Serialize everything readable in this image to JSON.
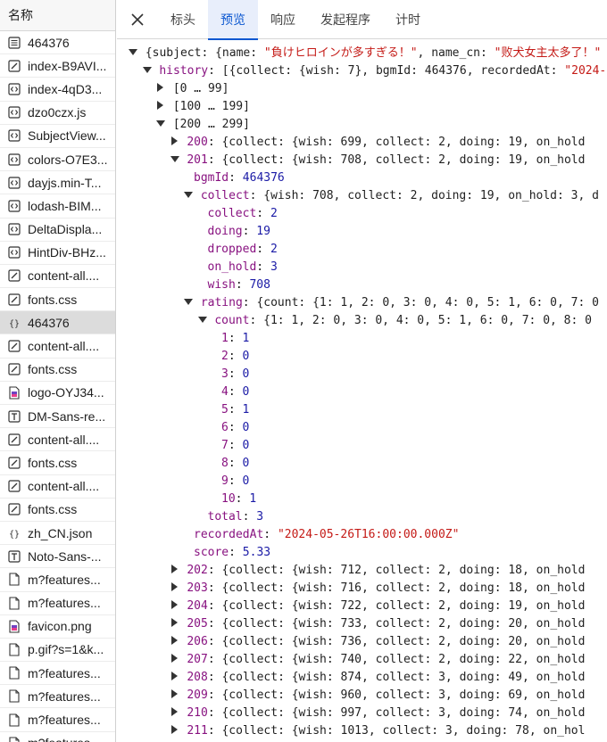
{
  "left_panel": {
    "header": "名称",
    "requests": [
      {
        "name": "464376",
        "icon": "document-icon",
        "selected": false
      },
      {
        "name": "index-B9AVI...",
        "icon": "script-icon",
        "selected": false
      },
      {
        "name": "index-4qD3...",
        "icon": "code-icon",
        "selected": false
      },
      {
        "name": "dzo0czx.js",
        "icon": "code-icon",
        "selected": false
      },
      {
        "name": "SubjectView...",
        "icon": "code-icon",
        "selected": false
      },
      {
        "name": "colors-O7E3...",
        "icon": "code-icon",
        "selected": false
      },
      {
        "name": "dayjs.min-T...",
        "icon": "code-icon",
        "selected": false
      },
      {
        "name": "lodash-BIM...",
        "icon": "code-icon",
        "selected": false
      },
      {
        "name": "DeltaDispla...",
        "icon": "code-icon",
        "selected": false
      },
      {
        "name": "HintDiv-BHz...",
        "icon": "code-icon",
        "selected": false
      },
      {
        "name": "content-all....",
        "icon": "script-icon",
        "selected": false
      },
      {
        "name": "fonts.css",
        "icon": "script-icon",
        "selected": false
      },
      {
        "name": "464376",
        "icon": "json-icon",
        "selected": true
      },
      {
        "name": "content-all....",
        "icon": "script-icon",
        "selected": false
      },
      {
        "name": "fonts.css",
        "icon": "script-icon",
        "selected": false
      },
      {
        "name": "logo-OYJ34...",
        "icon": "image-icon",
        "selected": false
      },
      {
        "name": "DM-Sans-re...",
        "icon": "font-icon",
        "selected": false
      },
      {
        "name": "content-all....",
        "icon": "script-icon",
        "selected": false
      },
      {
        "name": "fonts.css",
        "icon": "script-icon",
        "selected": false
      },
      {
        "name": "content-all....",
        "icon": "script-icon",
        "selected": false
      },
      {
        "name": "fonts.css",
        "icon": "script-icon",
        "selected": false
      },
      {
        "name": "zh_CN.json",
        "icon": "json-icon",
        "selected": false
      },
      {
        "name": "Noto-Sans-...",
        "icon": "font-icon",
        "selected": false
      },
      {
        "name": "m?features...",
        "icon": "file-icon",
        "selected": false
      },
      {
        "name": "m?features...",
        "icon": "file-icon",
        "selected": false
      },
      {
        "name": "favicon.png",
        "icon": "image-icon",
        "selected": false
      },
      {
        "name": "p.gif?s=1&k...",
        "icon": "file-icon",
        "selected": false
      },
      {
        "name": "m?features...",
        "icon": "file-icon",
        "selected": false
      },
      {
        "name": "m?features...",
        "icon": "file-icon",
        "selected": false
      },
      {
        "name": "m?features...",
        "icon": "file-icon",
        "selected": false
      },
      {
        "name": "m?features...",
        "icon": "file-icon",
        "selected": false
      }
    ]
  },
  "tabs": [
    {
      "label": "标头",
      "active": false
    },
    {
      "label": "预览",
      "active": true
    },
    {
      "label": "响应",
      "active": false
    },
    {
      "label": "发起程序",
      "active": false
    },
    {
      "label": "计时",
      "active": false
    }
  ],
  "tree": [
    {
      "indent": 0,
      "tri": "down",
      "parts": [
        [
          "p",
          "{subject: {name: "
        ],
        [
          "s",
          "\"負けヒロインが多すぎる！\""
        ],
        [
          "p",
          ", name_cn: "
        ],
        [
          "s",
          "\"败犬女主太多了！\""
        ]
      ]
    },
    {
      "indent": 1,
      "tri": "down",
      "parts": [
        [
          "k",
          "history"
        ],
        [
          "p",
          ": [{collect: {wish: 7}, bgmId: 464376, recordedAt: "
        ],
        [
          "s",
          "\"2024-"
        ]
      ]
    },
    {
      "indent": 2,
      "tri": "right",
      "parts": [
        [
          "p",
          "[0 … 99]"
        ]
      ]
    },
    {
      "indent": 2,
      "tri": "right",
      "parts": [
        [
          "p",
          "[100 … 199]"
        ]
      ]
    },
    {
      "indent": 2,
      "tri": "down",
      "parts": [
        [
          "p",
          "[200 … 299]"
        ]
      ]
    },
    {
      "indent": 3,
      "tri": "right",
      "parts": [
        [
          "k",
          "200"
        ],
        [
          "p",
          ": {collect: {wish: 699, collect: 2, doing: 19, on_hold"
        ]
      ]
    },
    {
      "indent": 3,
      "tri": "down",
      "parts": [
        [
          "k",
          "201"
        ],
        [
          "p",
          ": {collect: {wish: 708, collect: 2, doing: 19, on_hold"
        ]
      ]
    },
    {
      "indent": 4,
      "tri": "",
      "parts": [
        [
          "k",
          "bgmId"
        ],
        [
          "p",
          ": "
        ],
        [
          "n",
          "464376"
        ]
      ]
    },
    {
      "indent": 4,
      "tri": "down",
      "parts": [
        [
          "k",
          "collect"
        ],
        [
          "p",
          ": {wish: 708, collect: 2, doing: 19, on_hold: 3, d"
        ]
      ]
    },
    {
      "indent": 5,
      "tri": "",
      "parts": [
        [
          "k",
          "collect"
        ],
        [
          "p",
          ": "
        ],
        [
          "n",
          "2"
        ]
      ]
    },
    {
      "indent": 5,
      "tri": "",
      "parts": [
        [
          "k",
          "doing"
        ],
        [
          "p",
          ": "
        ],
        [
          "n",
          "19"
        ]
      ]
    },
    {
      "indent": 5,
      "tri": "",
      "parts": [
        [
          "k",
          "dropped"
        ],
        [
          "p",
          ": "
        ],
        [
          "n",
          "2"
        ]
      ]
    },
    {
      "indent": 5,
      "tri": "",
      "parts": [
        [
          "k",
          "on_hold"
        ],
        [
          "p",
          ": "
        ],
        [
          "n",
          "3"
        ]
      ]
    },
    {
      "indent": 5,
      "tri": "",
      "parts": [
        [
          "k",
          "wish"
        ],
        [
          "p",
          ": "
        ],
        [
          "n",
          "708"
        ]
      ]
    },
    {
      "indent": 4,
      "tri": "down",
      "parts": [
        [
          "k",
          "rating"
        ],
        [
          "p",
          ": {count: {1: 1, 2: 0, 3: 0, 4: 0, 5: 1, 6: 0, 7: 0"
        ]
      ]
    },
    {
      "indent": 5,
      "tri": "down",
      "parts": [
        [
          "k",
          "count"
        ],
        [
          "p",
          ": {1: 1, 2: 0, 3: 0, 4: 0, 5: 1, 6: 0, 7: 0, 8: 0"
        ]
      ]
    },
    {
      "indent": 6,
      "tri": "",
      "parts": [
        [
          "k",
          "1"
        ],
        [
          "p",
          ": "
        ],
        [
          "n",
          "1"
        ]
      ]
    },
    {
      "indent": 6,
      "tri": "",
      "parts": [
        [
          "k",
          "2"
        ],
        [
          "p",
          ": "
        ],
        [
          "n",
          "0"
        ]
      ]
    },
    {
      "indent": 6,
      "tri": "",
      "parts": [
        [
          "k",
          "3"
        ],
        [
          "p",
          ": "
        ],
        [
          "n",
          "0"
        ]
      ]
    },
    {
      "indent": 6,
      "tri": "",
      "parts": [
        [
          "k",
          "4"
        ],
        [
          "p",
          ": "
        ],
        [
          "n",
          "0"
        ]
      ]
    },
    {
      "indent": 6,
      "tri": "",
      "parts": [
        [
          "k",
          "5"
        ],
        [
          "p",
          ": "
        ],
        [
          "n",
          "1"
        ]
      ]
    },
    {
      "indent": 6,
      "tri": "",
      "parts": [
        [
          "k",
          "6"
        ],
        [
          "p",
          ": "
        ],
        [
          "n",
          "0"
        ]
      ]
    },
    {
      "indent": 6,
      "tri": "",
      "parts": [
        [
          "k",
          "7"
        ],
        [
          "p",
          ": "
        ],
        [
          "n",
          "0"
        ]
      ]
    },
    {
      "indent": 6,
      "tri": "",
      "parts": [
        [
          "k",
          "8"
        ],
        [
          "p",
          ": "
        ],
        [
          "n",
          "0"
        ]
      ]
    },
    {
      "indent": 6,
      "tri": "",
      "parts": [
        [
          "k",
          "9"
        ],
        [
          "p",
          ": "
        ],
        [
          "n",
          "0"
        ]
      ]
    },
    {
      "indent": 6,
      "tri": "",
      "parts": [
        [
          "k",
          "10"
        ],
        [
          "p",
          ": "
        ],
        [
          "n",
          "1"
        ]
      ]
    },
    {
      "indent": 5,
      "tri": "",
      "parts": [
        [
          "k",
          "total"
        ],
        [
          "p",
          ": "
        ],
        [
          "n",
          "3"
        ]
      ]
    },
    {
      "indent": 4,
      "tri": "",
      "parts": [
        [
          "k",
          "recordedAt"
        ],
        [
          "p",
          ": "
        ],
        [
          "s",
          "\"2024-05-26T16:00:00.000Z\""
        ]
      ]
    },
    {
      "indent": 4,
      "tri": "",
      "parts": [
        [
          "k",
          "score"
        ],
        [
          "p",
          ": "
        ],
        [
          "n",
          "5.33"
        ]
      ]
    },
    {
      "indent": 3,
      "tri": "right",
      "parts": [
        [
          "k",
          "202"
        ],
        [
          "p",
          ": {collect: {wish: 712, collect: 2, doing: 18, on_hold"
        ]
      ]
    },
    {
      "indent": 3,
      "tri": "right",
      "parts": [
        [
          "k",
          "203"
        ],
        [
          "p",
          ": {collect: {wish: 716, collect: 2, doing: 18, on_hold"
        ]
      ]
    },
    {
      "indent": 3,
      "tri": "right",
      "parts": [
        [
          "k",
          "204"
        ],
        [
          "p",
          ": {collect: {wish: 722, collect: 2, doing: 19, on_hold"
        ]
      ]
    },
    {
      "indent": 3,
      "tri": "right",
      "parts": [
        [
          "k",
          "205"
        ],
        [
          "p",
          ": {collect: {wish: 733, collect: 2, doing: 20, on_hold"
        ]
      ]
    },
    {
      "indent": 3,
      "tri": "right",
      "parts": [
        [
          "k",
          "206"
        ],
        [
          "p",
          ": {collect: {wish: 736, collect: 2, doing: 20, on_hold"
        ]
      ]
    },
    {
      "indent": 3,
      "tri": "right",
      "parts": [
        [
          "k",
          "207"
        ],
        [
          "p",
          ": {collect: {wish: 740, collect: 2, doing: 22, on_hold"
        ]
      ]
    },
    {
      "indent": 3,
      "tri": "right",
      "parts": [
        [
          "k",
          "208"
        ],
        [
          "p",
          ": {collect: {wish: 874, collect: 3, doing: 49, on_hold"
        ]
      ]
    },
    {
      "indent": 3,
      "tri": "right",
      "parts": [
        [
          "k",
          "209"
        ],
        [
          "p",
          ": {collect: {wish: 960, collect: 3, doing: 69, on_hold"
        ]
      ]
    },
    {
      "indent": 3,
      "tri": "right",
      "parts": [
        [
          "k",
          "210"
        ],
        [
          "p",
          ": {collect: {wish: 997, collect: 3, doing: 74, on_hold"
        ]
      ]
    },
    {
      "indent": 3,
      "tri": "right",
      "parts": [
        [
          "k",
          "211"
        ],
        [
          "p",
          ": {collect: {wish: 1013, collect: 3, doing: 78, on_hol"
        ]
      ]
    }
  ]
}
